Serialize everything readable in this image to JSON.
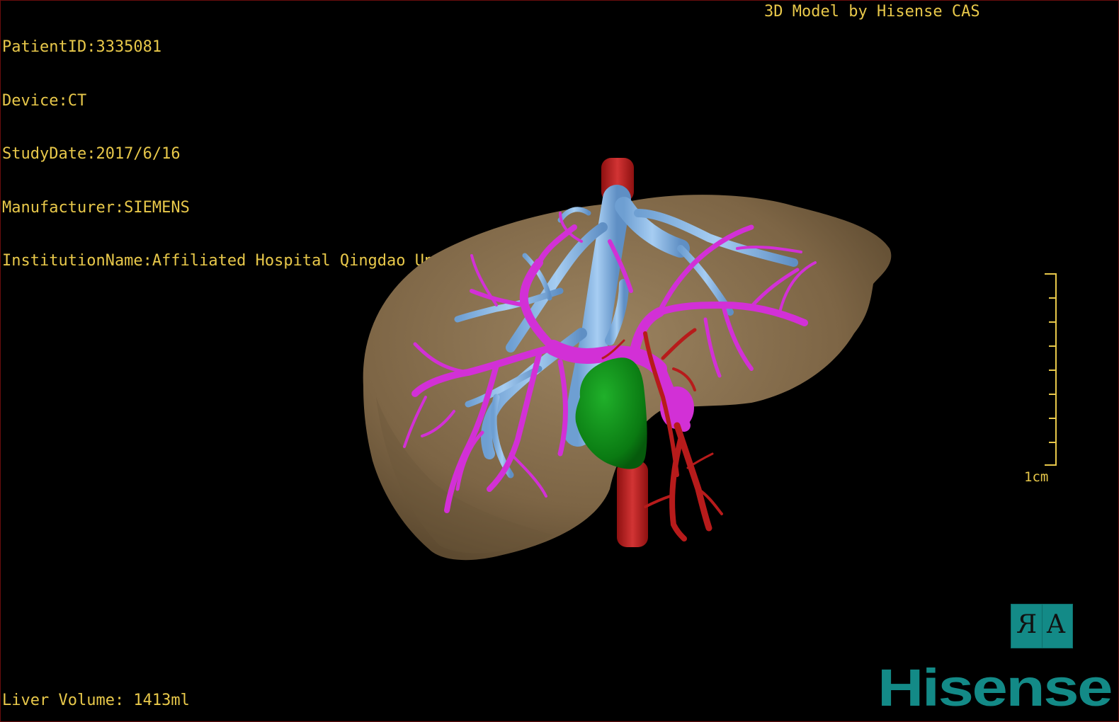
{
  "overlay": {
    "patient_id": "PatientID:3335081",
    "device": "Device:CT",
    "study_date": "StudyDate:2017/6/16",
    "manufacturer": "Manufacturer:SIEMENS",
    "institution": "InstitutionName:Affiliated Hospital Qingdao University-C",
    "credit": "3D Model by Hisense CAS",
    "liver_volume": "Liver Volume: 1413ml"
  },
  "scale": {
    "label": "1cm",
    "tick_count": 9
  },
  "orientation_button": {
    "left_glyph": "R",
    "right_glyph": "A"
  },
  "brand": {
    "logo_text": "Hisense"
  },
  "colors": {
    "overlay_text": "#e8c84a",
    "liver": "#8f7653",
    "portal_vein": "#d230d6",
    "hepatic_vein": "#7fb2e3",
    "artery": "#b71b1b",
    "tumor": "#0c8c15",
    "brand": "#138a87"
  }
}
